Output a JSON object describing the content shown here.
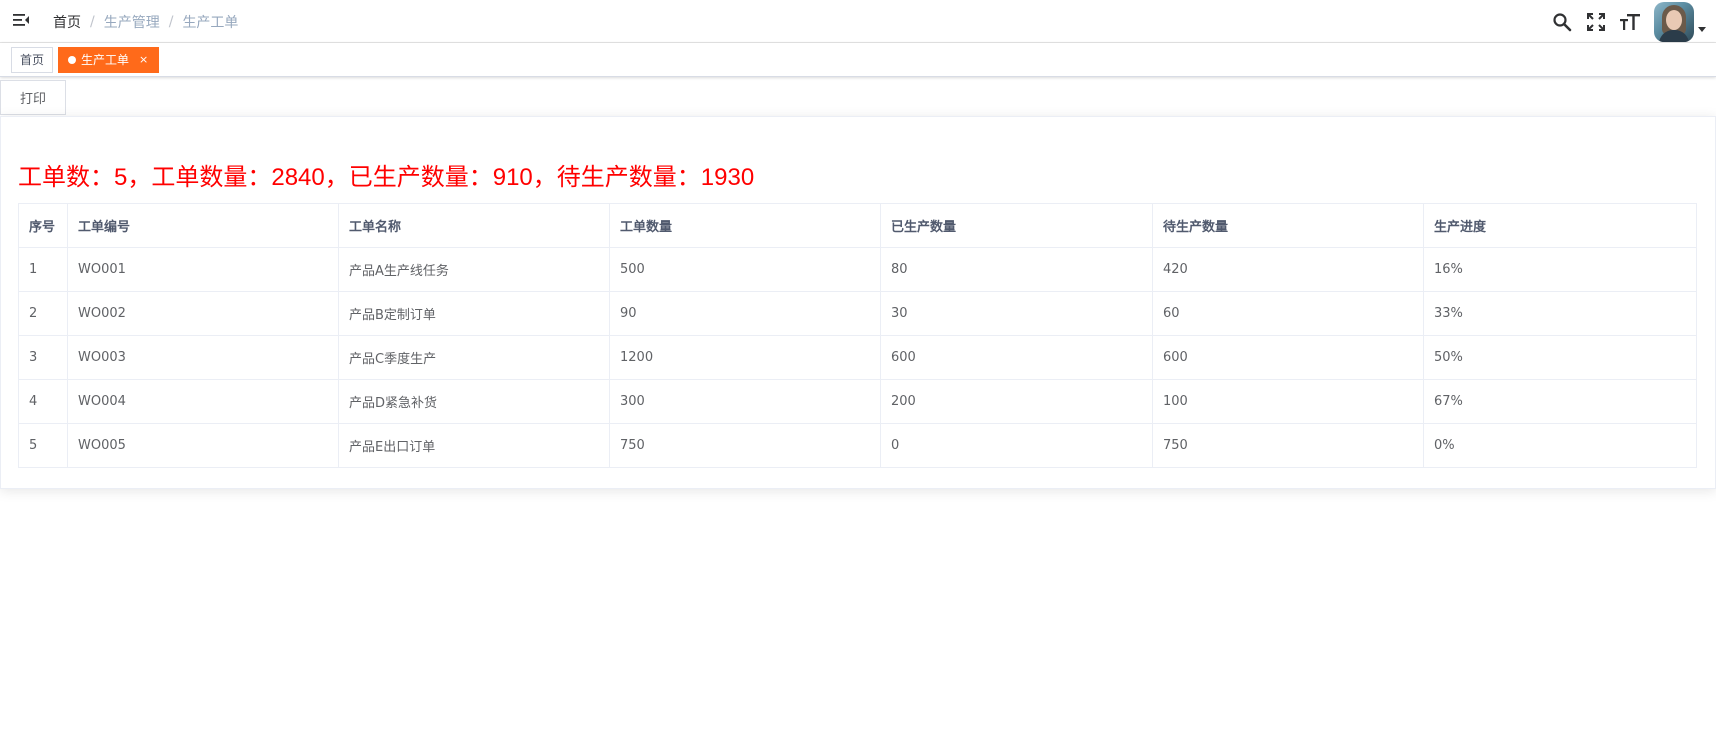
{
  "navbar": {
    "breadcrumb": {
      "home": "首页",
      "separator": "/",
      "level1": "生产管理",
      "level2": "生产工单"
    },
    "icons": [
      "hamburger-icon",
      "search-icon",
      "fullscreen-icon",
      "font-size-icon"
    ]
  },
  "tags": {
    "home": "首页",
    "active": "生产工单",
    "active_close": "×",
    "active_color": "#ff6a1a"
  },
  "toolbar": {
    "print_label": "打印"
  },
  "summary": {
    "text": "工单数：5，工单数量：2840，已生产数量：910，待生产数量：1930",
    "color": "#ff0000"
  },
  "table": {
    "columns": [
      "序号",
      "工单编号",
      "工单名称",
      "工单数量",
      "已生产数量",
      "待生产数量",
      "生产进度"
    ],
    "rows": [
      [
        "1",
        "WO001",
        "产品A生产线任务",
        "500",
        "80",
        "420",
        "16%"
      ],
      [
        "2",
        "WO002",
        "产品B定制订单",
        "90",
        "30",
        "60",
        "33%"
      ],
      [
        "3",
        "WO003",
        "产品C季度生产",
        "1200",
        "600",
        "600",
        "50%"
      ],
      [
        "4",
        "WO004",
        "产品D紧急补货",
        "300",
        "200",
        "100",
        "67%"
      ],
      [
        "5",
        "WO005",
        "产品E出口订单",
        "750",
        "0",
        "750",
        "0%"
      ]
    ]
  }
}
